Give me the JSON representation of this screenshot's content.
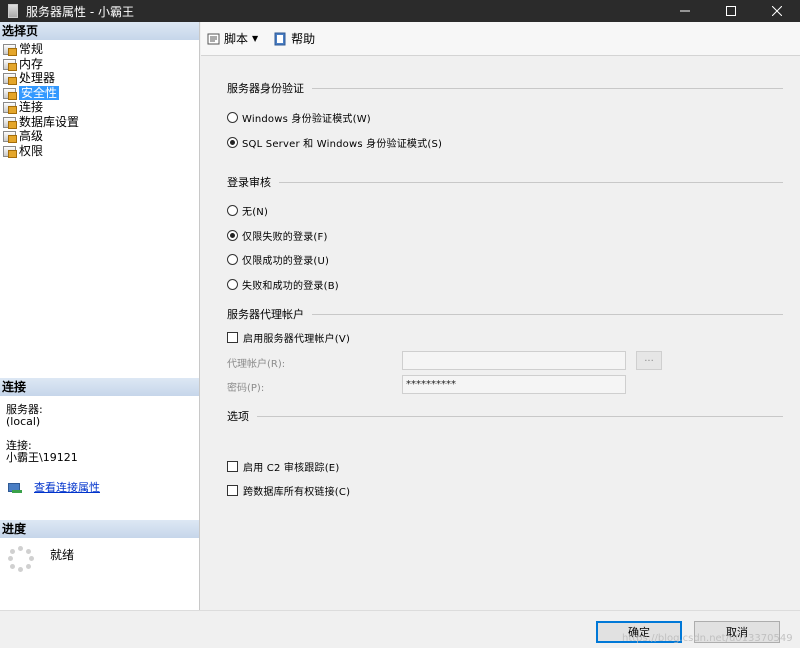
{
  "window": {
    "title": "服务器属性 - 小霸王"
  },
  "sidebar": {
    "header": "选择页",
    "items": [
      {
        "label": "常规"
      },
      {
        "label": "内存"
      },
      {
        "label": "处理器"
      },
      {
        "label": "安全性",
        "selected": true
      },
      {
        "label": "连接"
      },
      {
        "label": "数据库设置"
      },
      {
        "label": "高级"
      },
      {
        "label": "权限"
      }
    ]
  },
  "connection": {
    "header": "连接",
    "server_label": "服务器:",
    "server_value": "(local)",
    "conn_label": "连接:",
    "conn_value": "小霸王\\19121",
    "link_text": "查看连接属性"
  },
  "progress": {
    "header": "进度",
    "status": "就绪"
  },
  "toolbar": {
    "script_label": "脚本",
    "help_label": "帮助"
  },
  "security": {
    "auth_group": "服务器身份验证",
    "auth_options": [
      {
        "label": "Windows 身份验证模式(W)",
        "selected": false
      },
      {
        "label": "SQL Server 和 Windows 身份验证模式(S)",
        "selected": true
      }
    ],
    "audit_group": "登录审核",
    "audit_options": [
      {
        "label": "无(N)",
        "selected": false
      },
      {
        "label": "仅限失败的登录(F)",
        "selected": true
      },
      {
        "label": "仅限成功的登录(U)",
        "selected": false
      },
      {
        "label": "失败和成功的登录(B)",
        "selected": false
      }
    ],
    "proxy_group": "服务器代理帐户",
    "proxy_enable": "启用服务器代理帐户(V)",
    "proxy_account_label": "代理帐户(R):",
    "proxy_account_value": "",
    "password_label": "密码(P):",
    "password_value": "**********",
    "browse_label": "...",
    "options_group": "选项",
    "option_c2": "启用 C2 审核跟踪(E)",
    "option_cross_db": "跨数据库所有权链接(C)"
  },
  "buttons": {
    "ok": "确定",
    "cancel": "取消"
  },
  "watermark": "https://blog.csdn.net/u013370549"
}
